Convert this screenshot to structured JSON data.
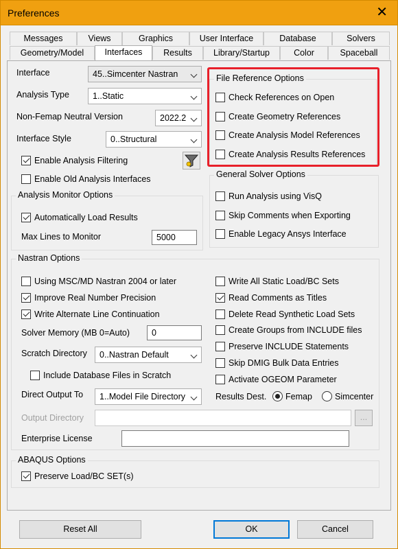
{
  "window": {
    "title": "Preferences",
    "close_symbol": "✕"
  },
  "tabs_row1": [
    "Messages",
    "Views",
    "Graphics",
    "User Interface",
    "Database",
    "Solvers"
  ],
  "tabs_row2": [
    "Geometry/Model",
    "Interfaces",
    "Results",
    "Library/Startup",
    "Color",
    "Spaceball"
  ],
  "interface": {
    "interface_label": "Interface",
    "interface_value": "45..Simcenter Nastran",
    "analysis_type_label": "Analysis Type",
    "analysis_type_value": "1..Static",
    "neutral_label": "Non-Femap Neutral Version",
    "neutral_value": "2022.2",
    "style_label": "Interface Style",
    "style_value": "0..Structural",
    "enable_filtering": "Enable Analysis Filtering",
    "enable_old": "Enable Old Analysis Interfaces"
  },
  "monitor": {
    "title": "Analysis Monitor Options",
    "auto_load": "Automatically Load Results",
    "max_lines_label": "Max Lines to Monitor",
    "max_lines_value": "5000"
  },
  "file_ref": {
    "title": "File Reference Options",
    "items": [
      "Check References on Open",
      "Create Geometry References",
      "Create Analysis Model References",
      "Create Analysis Results References"
    ]
  },
  "general_solver": {
    "title": "General Solver Options",
    "items": [
      "Run Analysis using VisQ",
      "Skip Comments when Exporting",
      "Enable Legacy Ansys Interface"
    ]
  },
  "nastran": {
    "title": "Nastran Options",
    "left_checks": [
      "Using MSC/MD Nastran 2004 or later",
      "Improve Real Number Precision",
      "Write Alternate Line Continuation"
    ],
    "solver_mem_label": "Solver Memory (MB 0=Auto)",
    "solver_mem_value": "0",
    "scratch_label": "Scratch Directory",
    "scratch_value": "0..Nastran Default",
    "include_db": "Include Database Files in Scratch",
    "direct_output_label": "Direct Output To",
    "direct_output_value": "1..Model File Directory",
    "output_dir_label": "Output Directory",
    "output_dir_value": "",
    "browse": "...",
    "enterprise_label": "Enterprise License",
    "enterprise_value": "",
    "right_checks": [
      "Write All Static Load/BC Sets",
      "Read Comments as Titles",
      "Delete Read Synthetic Load Sets",
      "Create Groups from INCLUDE files",
      "Preserve INCLUDE Statements",
      "Skip DMIG Bulk Data Entries",
      "Activate OGEOM Parameter"
    ],
    "results_dest_label": "Results Dest.",
    "radio_femap": "Femap",
    "radio_simcenter": "Simcenter"
  },
  "abaqus": {
    "title": "ABAQUS Options",
    "preserve": "Preserve Load/BC SET(s)"
  },
  "buttons": {
    "reset": "Reset All",
    "ok": "OK",
    "cancel": "Cancel"
  },
  "colors": {
    "titlebar": "#f0a010",
    "highlight": "#e8202a",
    "default_button": "#0078d7"
  }
}
